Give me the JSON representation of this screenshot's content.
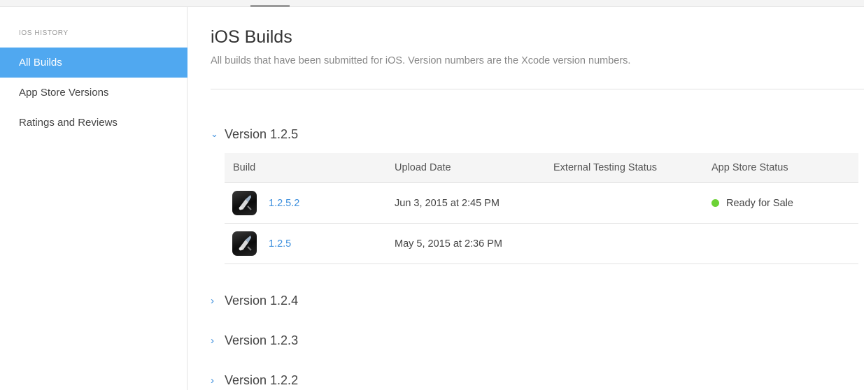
{
  "sidebar": {
    "heading": "iOS HISTORY",
    "items": [
      {
        "label": "All Builds",
        "active": true
      },
      {
        "label": "App Store Versions",
        "active": false
      },
      {
        "label": "Ratings and Reviews",
        "active": false
      }
    ]
  },
  "main": {
    "title": "iOS Builds",
    "subtitle": "All builds that have been submitted for iOS. Version numbers are the Xcode version numbers.",
    "table": {
      "columns": [
        "Build",
        "Upload Date",
        "External Testing Status",
        "App Store Status"
      ]
    },
    "versions": [
      {
        "label": "Version 1.2.5",
        "expanded": true,
        "chevron": "chevron-down-icon",
        "builds": [
          {
            "build": "1.2.5.2",
            "upload_date": "Jun 3, 2015 at 2:45 PM",
            "external_testing_status": "",
            "app_store_status": "Ready for Sale",
            "status_color": "#6cd236"
          },
          {
            "build": "1.2.5",
            "upload_date": "May 5, 2015 at 2:36 PM",
            "external_testing_status": "",
            "app_store_status": "",
            "status_color": ""
          }
        ]
      },
      {
        "label": "Version 1.2.4",
        "expanded": false,
        "chevron": "chevron-right-icon"
      },
      {
        "label": "Version 1.2.3",
        "expanded": false,
        "chevron": "chevron-right-icon"
      },
      {
        "label": "Version 1.2.2",
        "expanded": false,
        "chevron": "chevron-right-icon"
      }
    ]
  },
  "colors": {
    "accent": "#3d8fdd",
    "sidebar_active": "#50a8f0",
    "ready_for_sale": "#6cd236"
  }
}
